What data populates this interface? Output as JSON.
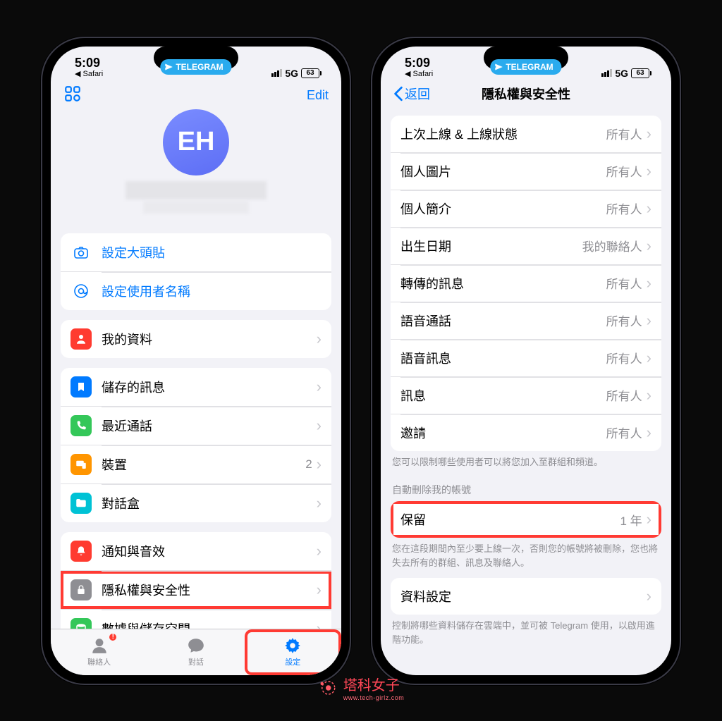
{
  "status": {
    "time": "5:09",
    "back_app": "Safari",
    "network": "5G",
    "battery": "63"
  },
  "pill": "TELEGRAM",
  "left": {
    "edit": "Edit",
    "avatar_initials": "EH",
    "links": {
      "set_photo": "設定大頭貼",
      "set_username": "設定使用者名稱"
    },
    "rows": {
      "my_profile": "我的資料",
      "saved_messages": "儲存的訊息",
      "recent_calls": "最近通話",
      "devices": "裝置",
      "devices_count": "2",
      "chat_folders": "對話盒",
      "notifications": "通知與音效",
      "privacy": "隱私權與安全性",
      "data_storage": "數據與儲存空間"
    },
    "tabs": {
      "contacts": "聯絡人",
      "chats": "對話",
      "settings": "設定"
    }
  },
  "right": {
    "back": "返回",
    "title": "隱私權與安全性",
    "rows": {
      "last_seen": {
        "label": "上次上線 & 上線狀態",
        "value": "所有人"
      },
      "profile_photo": {
        "label": "個人圖片",
        "value": "所有人"
      },
      "bio": {
        "label": "個人簡介",
        "value": "所有人"
      },
      "birthday": {
        "label": "出生日期",
        "value": "我的聯絡人"
      },
      "forwarded": {
        "label": "轉傳的訊息",
        "value": "所有人"
      },
      "calls": {
        "label": "語音通話",
        "value": "所有人"
      },
      "voice_msgs": {
        "label": "語音訊息",
        "value": "所有人"
      },
      "messages": {
        "label": "訊息",
        "value": "所有人"
      },
      "invites": {
        "label": "邀請",
        "value": "所有人"
      }
    },
    "footer1": "您可以限制哪些使用者可以將您加入至群組和頻道。",
    "auto_delete_header": "自動刪除我的帳號",
    "keep": {
      "label": "保留",
      "value": "1 年"
    },
    "footer2": "您在這段期間內至少要上線一次，否則您的帳號將被刪除，您也將失去所有的群組、訊息及聯絡人。",
    "data_settings": "資料設定",
    "footer3": "控制將哪些資料儲存在雲端中，並可被 Telegram 使用，以啟用進階功能。"
  },
  "watermark": {
    "text": "塔科女子",
    "url": "www.tech-girlz.com"
  }
}
